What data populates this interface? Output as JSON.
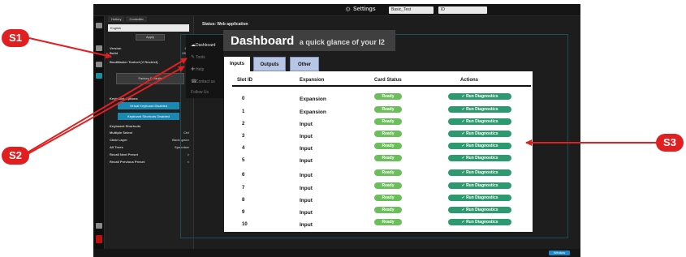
{
  "callouts": {
    "s1": "S1",
    "s2": "S2",
    "s3": "S3"
  },
  "topbar": {
    "settings_label": "Settings",
    "select1_value": "Basic_Test",
    "select2_value": "ID"
  },
  "sidepanel": {
    "tabs": [
      "Hotkey",
      "Controller"
    ],
    "language_value": "English",
    "apply_label": "Apply",
    "version_label": "Version",
    "version_value": "4.8",
    "build_label": "Build",
    "build_value": "2355",
    "boot_label": "BootMaster Toolset (V Restrict)",
    "factory_label": "Factory Defaults",
    "keyboard_options_label": "Keyboard Options",
    "teal_btn_1": "Virtual Keyboard Disabled",
    "teal_btn_2": "Keyboard Shortcuts Disabled",
    "shortcuts_header": "Keyboard Shortcuts",
    "shortcuts": [
      {
        "label": "Multiple Select",
        "value": "Ctrl"
      },
      {
        "label": "Clear Layer",
        "value": "Backspace"
      },
      {
        "label": "All Trees",
        "value": "Spacebar"
      },
      {
        "label": "Recall Next Preset",
        "value": ">"
      },
      {
        "label": "Recall Previous Preset",
        "value": "<"
      }
    ]
  },
  "status_text": "Status: Web application",
  "nav": {
    "items": [
      "Dashboard",
      "Tools",
      "Help",
      "Contact us",
      "Follow Us"
    ]
  },
  "dashboard": {
    "title": "Dashboard",
    "subtitle": "a quick glance of your I2"
  },
  "tabs": [
    "Inputs",
    "Outputs",
    "Other"
  ],
  "table": {
    "headers": {
      "slot": "Slot ID",
      "expansion": "Expansion",
      "status": "Card Status",
      "actions": "Actions"
    },
    "rows": [
      {
        "id": "0",
        "expansion": "Expansion",
        "status": "Ready",
        "action": "Run Diagnostics"
      },
      {
        "id": "1",
        "expansion": "Expansion",
        "status": "Ready",
        "action": "Run Diagnostics"
      },
      {
        "id": "2",
        "expansion": "Input",
        "status": "Ready",
        "action": "Run Diagnostics"
      },
      {
        "id": "3",
        "expansion": "Input",
        "status": "Ready",
        "action": "Run Diagnostics"
      },
      {
        "id": "4",
        "expansion": "Input",
        "status": "Ready",
        "action": "Run Diagnostics"
      },
      {
        "id": "5",
        "expansion": "Input",
        "status": "Ready",
        "action": "Run Diagnostics"
      },
      {
        "id": "6",
        "expansion": "Input",
        "status": "Ready",
        "action": "Run Diagnostics"
      },
      {
        "id": "7",
        "expansion": "Input",
        "status": "Ready",
        "action": "Run Diagnostics"
      },
      {
        "id": "8",
        "expansion": "Input",
        "status": "Ready",
        "action": "Run Diagnostics"
      },
      {
        "id": "9",
        "expansion": "Input",
        "status": "Ready",
        "action": "Run Diagnostics"
      },
      {
        "id": "10",
        "expansion": "Input",
        "status": "Ready",
        "action": "Run Diagnostics"
      }
    ]
  },
  "bottombar": {
    "window_label": "Window"
  },
  "colors": {
    "callout": "#e02020",
    "ready": "#6bbf5a",
    "action": "#2c9a6e",
    "tab_inactive": "#b7c6e4",
    "accent": "#1a88b0"
  }
}
